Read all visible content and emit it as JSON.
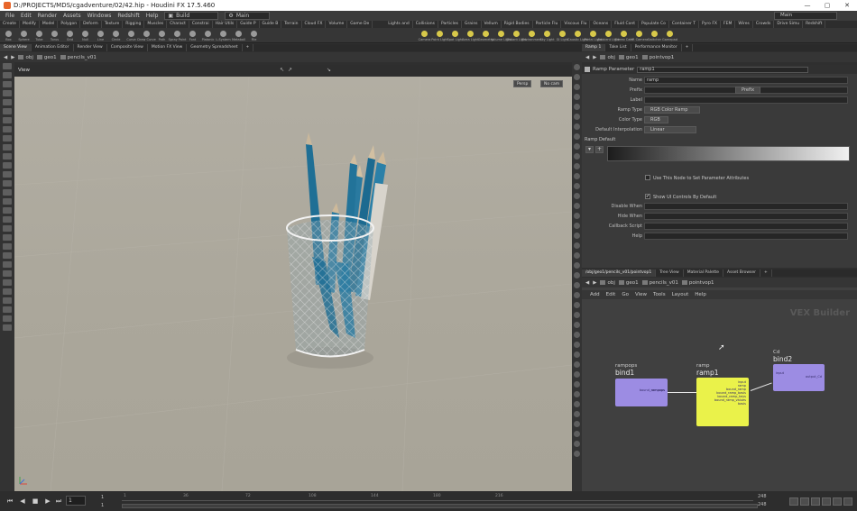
{
  "window": {
    "title": "D:/PROJECTS/MDS/cgadventure/02/42.hip - Houdini FX 17.5.460",
    "controls": [
      "—",
      "▢",
      "✕"
    ]
  },
  "menu": {
    "items": [
      "File",
      "Edit",
      "Render",
      "Assets",
      "Windows",
      "Redshift",
      "Help"
    ],
    "desktop_left": "Build",
    "desktop_mid": "Main",
    "desktop_right": "Main"
  },
  "shelf": {
    "tabs": [
      "Create",
      "Modify",
      "Model",
      "Polygon",
      "Deform",
      "Texture",
      "Rigging",
      "Muscles",
      "Charact",
      "Constrai",
      "Hair Utils",
      "Guide P",
      "Guide B",
      "Terrain",
      "Cloud FX",
      "Volume",
      "Game De"
    ],
    "tabs_right": [
      "Lights and",
      "Collisions",
      "Particles",
      "Grains",
      "Vellum",
      "Rigid Bodies",
      "Particle Flu",
      "Viscous Flu",
      "Oceans",
      "Fluid Cont",
      "Populate Co",
      "Container T",
      "Pyro FX",
      "FEM",
      "Wires",
      "Crowds",
      "Drive Simu",
      "Redshift"
    ],
    "tools": [
      "Box",
      "Sphere",
      "Tube",
      "Torus",
      "Grid",
      "Null",
      "Line",
      "Circle",
      "Curve",
      "Draw Curve",
      "Path",
      "Spray Paint",
      "Font",
      "Platonic",
      "L-System",
      "Metaball",
      "File"
    ],
    "tools_right": [
      "Camera",
      "Point Light",
      "Spot Light",
      "Area Light",
      "Geometry",
      "Volume Light",
      "Distant Light",
      "Environment",
      "Sky Light",
      "GI Light",
      "Caustic Light",
      "Portal Light",
      "Ambient Light",
      "Stereo Cam",
      "VR Camera",
      "Switcher",
      "Gamepad"
    ]
  },
  "left_pane": {
    "tabs": [
      "Scene View",
      "Animation Editor",
      "Render View",
      "Composite View",
      "Motion FX View",
      "Geometry Spreadsheet"
    ],
    "path": [
      "obj",
      "geo1",
      "pencils_v01"
    ],
    "view_label": "View",
    "camera_dd": "Persp",
    "display_dd": "No cam"
  },
  "param_pane": {
    "tabs": [
      "Ramp 1",
      "Take List",
      "Performance Monitor"
    ],
    "path": [
      "obj",
      "geo1",
      "pointvop1"
    ],
    "node_type": "Ramp Parameter",
    "node_name": "ramp1",
    "name": {
      "label": "Name",
      "value": "ramp"
    },
    "prefix": {
      "label": "Prefix",
      "button": "Prefix"
    },
    "label": {
      "label": "Label",
      "value": ""
    },
    "ramp_type": {
      "label": "Ramp Type",
      "value": "RGB Color Ramp"
    },
    "color_type": {
      "label": "Color Type",
      "value": "RGB"
    },
    "default_interp": {
      "label": "Default Interpolation",
      "value": "Linear"
    },
    "ramp_default_label": "Ramp Default",
    "use_node_label": "Use This Node to Set Parameter Attributes",
    "show_ui_label": "Show UI Controls By Default",
    "show_ui_checked": "✔",
    "disable_when": "Disable When",
    "hide_when": "Hide When",
    "callback": "Callback Script",
    "help": "Help"
  },
  "network_pane": {
    "tabs": [
      "/obj/geo1/pencils_v01/pointvop1",
      "Tree View",
      "Material Palette",
      "Asset Browser"
    ],
    "path": [
      "obj",
      "geo1",
      "pencils_v01",
      "pointvop1"
    ],
    "menu": [
      "Add",
      "Edit",
      "Go",
      "View",
      "Tools",
      "Layout",
      "Help"
    ],
    "context_label": "VEX Builder",
    "nodes": [
      {
        "label": "rampops",
        "name": "bind1",
        "ports": [
          "rampops",
          "bound_rampops"
        ]
      },
      {
        "label": "ramp",
        "name": "ramp1",
        "ports": [
          "input",
          "ramp",
          "bound_ramp",
          "bound_ramp_basis",
          "bound_ramp_keys",
          "bound_ramp_values",
          "basis"
        ]
      },
      {
        "label": "Cd",
        "name": "bind2",
        "ports": [
          "input",
          "output_Cd"
        ]
      }
    ]
  },
  "timeline": {
    "current_frame": "1",
    "start": "1",
    "end_top": "248",
    "end_bottom": "248",
    "ticks": [
      "1",
      "36",
      "72",
      "108",
      "144",
      "180",
      "216"
    ],
    "buttons": [
      "⏮",
      "◀",
      "■",
      "▶",
      "⏭"
    ]
  }
}
